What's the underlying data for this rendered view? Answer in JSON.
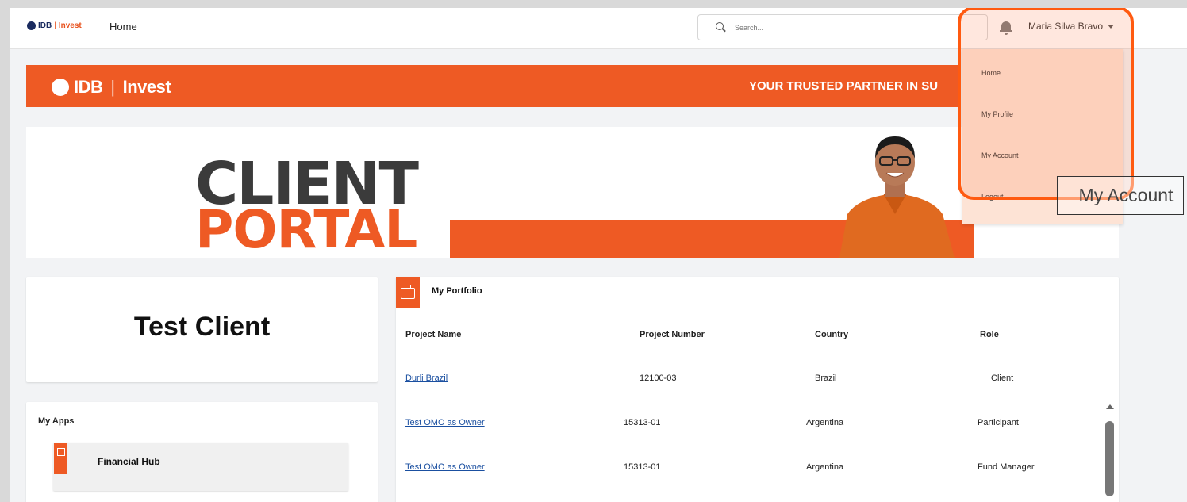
{
  "topnav": {
    "brand_idb": "IDB",
    "brand_sep": "|",
    "brand_invest": "Invest",
    "home": "Home",
    "search_placeholder": "Search...",
    "user_name": "Maria Silva Bravo"
  },
  "banner": {
    "brand_idb": "IDB",
    "brand_sep": "|",
    "brand_invest": "Invest",
    "tagline": "YOUR TRUSTED PARTNER IN SU"
  },
  "hero": {
    "line1": "CLIENT",
    "line2": "PORTAL"
  },
  "dropdown": {
    "items": [
      "Home",
      "My Profile",
      "My Account",
      "Logout"
    ]
  },
  "tooltip": "My Account",
  "client": {
    "name": "Test Client"
  },
  "apps": {
    "title": "My Apps",
    "items": [
      {
        "label": "Financial Hub"
      }
    ]
  },
  "portfolio": {
    "title": "My Portfolio",
    "columns": [
      "Project Name",
      "Project Number",
      "Country",
      "Role"
    ],
    "rows": [
      [
        "Durli Brazil",
        "12100-03",
        "Brazil",
        "Client"
      ],
      [
        "Test OMO as Owner",
        "15313-01",
        "Argentina",
        "Participant"
      ],
      [
        "Test OMO as Owner",
        "15313-01",
        "Argentina",
        "Fund Manager"
      ]
    ]
  },
  "colors": {
    "brand_orange": "#ee5a24",
    "navy": "#1a2b5f",
    "highlight": "#ff5a10"
  }
}
